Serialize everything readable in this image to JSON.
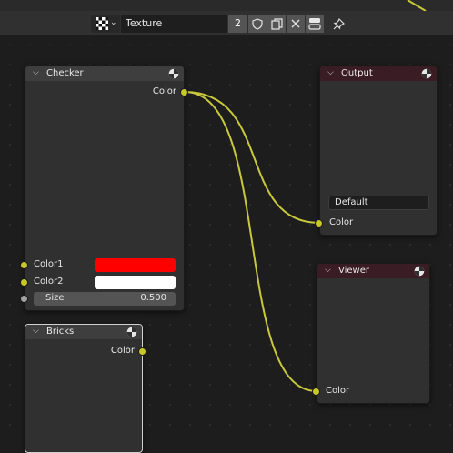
{
  "header": {
    "texture_name": "Texture",
    "users": "2",
    "icons": [
      "checker-texture-icon",
      "chevron-down-icon",
      "shield-icon",
      "duplicate-icon",
      "close-icon",
      "toggle-icon",
      "pin-icon"
    ]
  },
  "nodes": {
    "checker": {
      "title": "Checker",
      "output_label": "Color",
      "inputs": {
        "color1_label": "Color1",
        "color1_value": "#ff0000",
        "color2_label": "Color2",
        "color2_value": "#ffffff",
        "size_label": "Size",
        "size_value": "0.500"
      }
    },
    "output": {
      "title": "Output",
      "name_field": "Default",
      "input_label": "Color"
    },
    "viewer": {
      "title": "Viewer",
      "input_label": "Color"
    },
    "bricks": {
      "title": "Bricks",
      "output_label": "Color"
    }
  },
  "colors": {
    "socket_color": "#c7c729",
    "link_color": "#c8c83c",
    "output_header": "#3a1c25",
    "node_body": "#303030",
    "background": "#1d1d1d"
  }
}
